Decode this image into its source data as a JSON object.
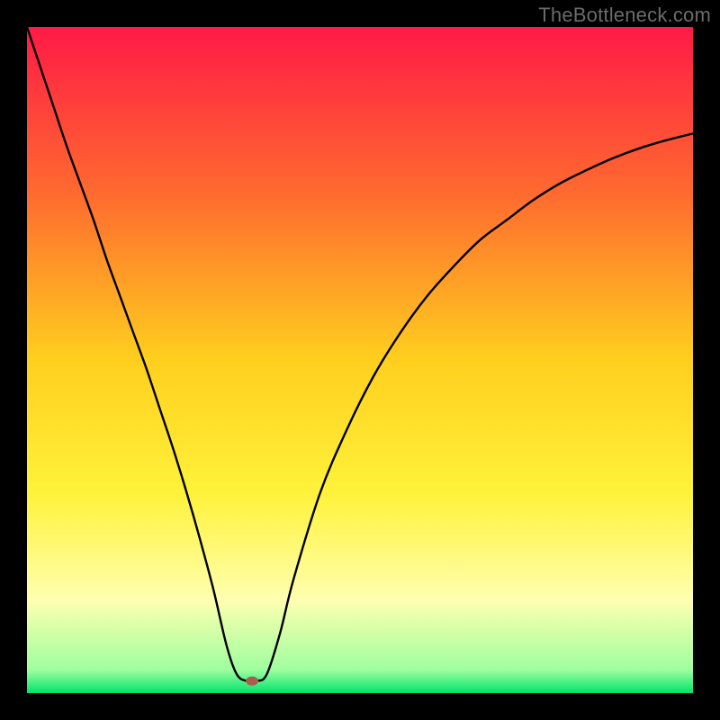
{
  "watermark": "TheBottleneck.com",
  "chart_data": {
    "type": "line",
    "title": "",
    "xlabel": "",
    "ylabel": "",
    "xlim": [
      0,
      100
    ],
    "ylim": [
      0,
      100
    ],
    "grid": false,
    "legend": false,
    "background_gradient": {
      "stops": [
        {
          "pos": 0.0,
          "color": "#ff1a46"
        },
        {
          "pos": 0.25,
          "color": "#ff6a2f"
        },
        {
          "pos": 0.5,
          "color": "#ffcf1e"
        },
        {
          "pos": 0.7,
          "color": "#fff23a"
        },
        {
          "pos": 0.86,
          "color": "#ffffb0"
        },
        {
          "pos": 0.965,
          "color": "#9fff9f"
        },
        {
          "pos": 1.0,
          "color": "#00e46a"
        }
      ]
    },
    "series": [
      {
        "name": "bottleneck-curve",
        "x": [
          0,
          2,
          4,
          6,
          8,
          10,
          12,
          14,
          16,
          18,
          20,
          22,
          24,
          26,
          28,
          30,
          31.5,
          33,
          34.5,
          36,
          38,
          40,
          44,
          48,
          52,
          56,
          60,
          64,
          68,
          72,
          76,
          80,
          84,
          88,
          92,
          96,
          100
        ],
        "values": [
          100,
          94,
          88,
          82,
          76.5,
          71,
          65,
          59.5,
          54,
          48.5,
          42.5,
          36.5,
          30,
          23,
          15.5,
          7,
          2.8,
          1.8,
          1.8,
          2.8,
          9,
          17,
          30,
          39.5,
          47.5,
          54,
          59.5,
          64,
          68,
          71,
          74,
          76.5,
          78.5,
          80.3,
          81.8,
          83,
          84
        ]
      }
    ],
    "marker": {
      "name": "minimum-point",
      "x": 33.8,
      "y": 1.8,
      "color": "#aa5c4e",
      "rx": 7,
      "ry": 5
    }
  }
}
